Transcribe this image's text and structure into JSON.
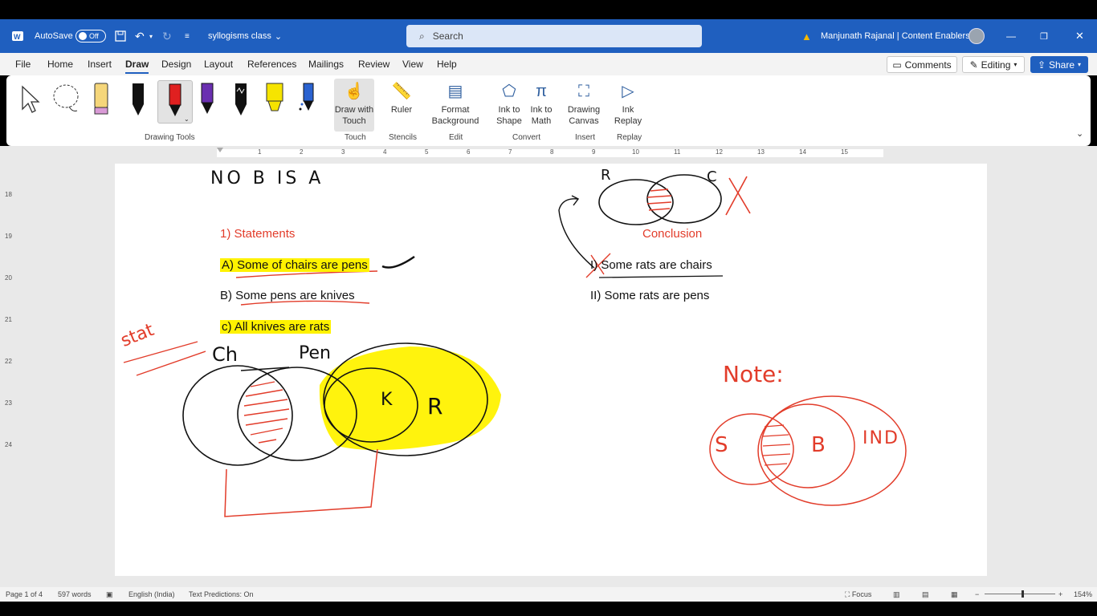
{
  "titlebar": {
    "autosave_label": "AutoSave",
    "autosave_state": "Off",
    "doc_title": "syllogisms class",
    "search_placeholder": "Search",
    "user": "Manjunath Rajanal | Content Enablers"
  },
  "menu": {
    "tabs": [
      "File",
      "Home",
      "Insert",
      "Draw",
      "Design",
      "Layout",
      "References",
      "Mailings",
      "Review",
      "View",
      "Help"
    ],
    "comments": "Comments",
    "editing": "Editing",
    "share": "Share"
  },
  "ribbon": {
    "draw_with_touch": "Draw with Touch",
    "ruler": "Ruler",
    "format_background": "Format Background",
    "ink_to_shape": "Ink to Shape",
    "ink_to_math": "Ink to Math",
    "drawing_canvas": "Drawing Canvas",
    "ink_replay": "Ink Replay",
    "groups": {
      "drawing_tools": "Drawing Tools",
      "touch": "Touch",
      "stencils": "Stencils",
      "edit": "Edit",
      "convert": "Convert",
      "insert": "Insert",
      "replay": "Replay"
    }
  },
  "ruler_ticks": [
    "1",
    "2",
    "3",
    "4",
    "5",
    "6",
    "7",
    "8",
    "9",
    "10",
    "11",
    "12",
    "13",
    "14",
    "15"
  ],
  "vruler_ticks": [
    "18",
    "19",
    "20",
    "21",
    "22",
    "23",
    "24"
  ],
  "document": {
    "heading_ink": "NO B IS A",
    "statements_heading": "1) Statements",
    "statement_a": "A) Some of chairs are pens",
    "statement_b": "B) Some pens are knives",
    "statement_c": "c) All knives are rats",
    "conclusion_heading": "Conclusion",
    "conclusion_1": "I) Some rats are chairs",
    "conclusion_2": "II) Some rats are pens"
  },
  "ink_labels": {
    "stat": "stat",
    "ch": "Ch",
    "pen": "Pen",
    "k": "K",
    "r": "R",
    "venn_r": "R",
    "venn_c": "C",
    "note": "Note:",
    "s": "S",
    "b": "B",
    "ind": "IND"
  },
  "status": {
    "page": "Page 1 of 4",
    "words": "597 words",
    "language": "English (India)",
    "predictions": "Text Predictions: On",
    "focus": "Focus",
    "zoom": "154%"
  },
  "colors": {
    "accent": "#1f5fbf",
    "ink_red": "#e23c2a",
    "highlight": "#fff200"
  }
}
